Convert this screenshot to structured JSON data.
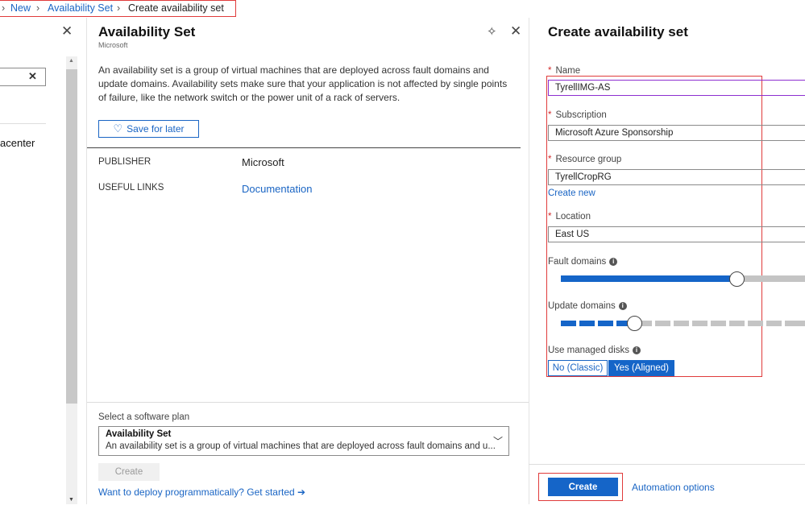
{
  "breadcrumb": {
    "items": [
      "New",
      "Availability Set",
      "Create availability set"
    ]
  },
  "left_panel": {
    "partial_label": "acenter"
  },
  "middle_panel": {
    "title": "Availability Set",
    "subtitle": "Microsoft",
    "description": "An availability set is a group of virtual machines that are deployed across fault domains and update domains. Availability sets make sure that your application is not affected by single points of failure, like the network switch or the power unit of a rack of servers.",
    "save_label": "Save for later",
    "publisher_key": "PUBLISHER",
    "publisher_value": "Microsoft",
    "links_key": "USEFUL LINKS",
    "links_value": "Documentation",
    "plan_label": "Select a software plan",
    "plan_name": "Availability Set",
    "plan_desc": "An availability set is a group of virtual machines that are deployed across fault domains and u...",
    "create_label": "Create",
    "deploy_link": "Want to deploy programmatically? Get started ➔"
  },
  "right_panel": {
    "title": "Create availability set",
    "name_label": "Name",
    "name_value": "TyrellIMG-AS",
    "subscription_label": "Subscription",
    "subscription_value": "Microsoft Azure Sponsorship",
    "resource_group_label": "Resource group",
    "resource_group_value": "TyrellCropRG",
    "create_new": "Create new",
    "location_label": "Location",
    "location_value": "East US",
    "fault_domains_label": "Fault domains",
    "update_domains_label": "Update domains",
    "managed_disks_label": "Use managed disks",
    "option_no": "No (Classic)",
    "option_yes": "Yes (Aligned)",
    "create_label": "Create",
    "automation_label": "Automation options"
  },
  "colors": {
    "accent": "#1565c8",
    "highlight_border": "#e03b3b",
    "slider_inactive": "#c4c4c4"
  }
}
